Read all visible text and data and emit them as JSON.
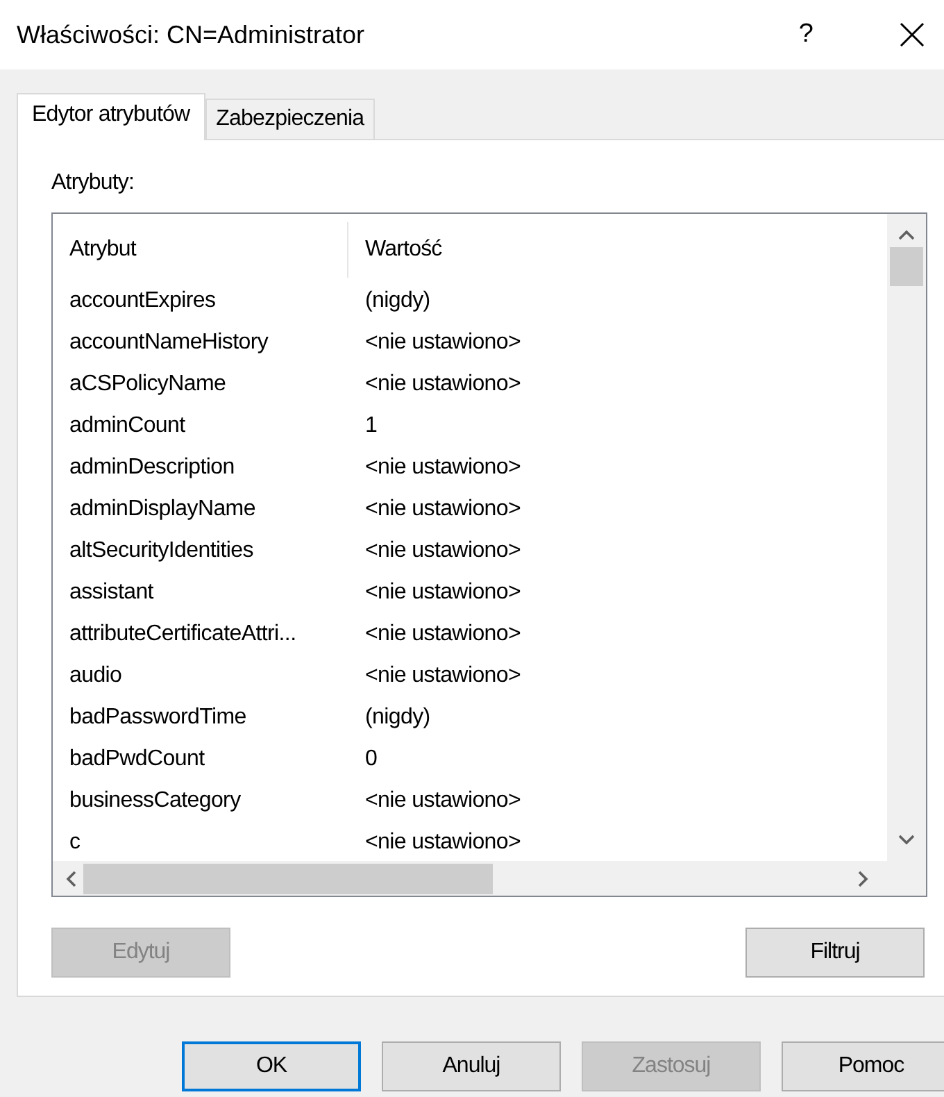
{
  "window": {
    "title": "Właściwości: CN=Administrator",
    "help": "?"
  },
  "tabs": [
    {
      "label": "Edytor atrybutów",
      "selected": true
    },
    {
      "label": "Zabezpieczenia",
      "selected": false
    }
  ],
  "attributes_label": "Atrybuty:",
  "table": {
    "columns": [
      "Atrybut",
      "Wartość"
    ],
    "rows": [
      {
        "attribute": "accountExpires",
        "value": "(nigdy)"
      },
      {
        "attribute": "accountNameHistory",
        "value": "<nie ustawiono>"
      },
      {
        "attribute": "aCSPolicyName",
        "value": "<nie ustawiono>"
      },
      {
        "attribute": "adminCount",
        "value": "1"
      },
      {
        "attribute": "adminDescription",
        "value": "<nie ustawiono>"
      },
      {
        "attribute": "adminDisplayName",
        "value": "<nie ustawiono>"
      },
      {
        "attribute": "altSecurityIdentities",
        "value": "<nie ustawiono>"
      },
      {
        "attribute": "assistant",
        "value": "<nie ustawiono>"
      },
      {
        "attribute": "attributeCertificateAttri...",
        "value": "<nie ustawiono>"
      },
      {
        "attribute": "audio",
        "value": "<nie ustawiono>"
      },
      {
        "attribute": "badPasswordTime",
        "value": "(nigdy)"
      },
      {
        "attribute": "badPwdCount",
        "value": "0"
      },
      {
        "attribute": "businessCategory",
        "value": "<nie ustawiono>"
      },
      {
        "attribute": "c",
        "value": "<nie ustawiono>"
      }
    ]
  },
  "panel_buttons": [
    {
      "label": "Edytuj",
      "disabled": true
    },
    {
      "label": "Filtruj",
      "disabled": false
    }
  ],
  "dialog_buttons": [
    {
      "label": "OK",
      "disabled": false,
      "default": true
    },
    {
      "label": "Anuluj",
      "disabled": false,
      "default": false
    },
    {
      "label": "Zastosuj",
      "disabled": true,
      "default": false
    },
    {
      "label": "Pomoc",
      "disabled": false,
      "default": false
    }
  ]
}
